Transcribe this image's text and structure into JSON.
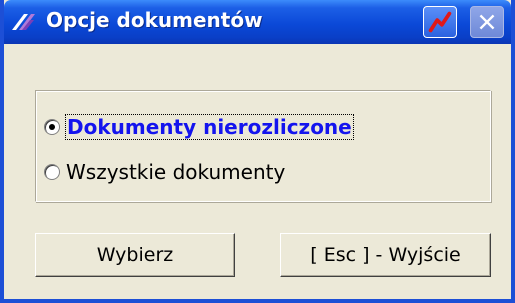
{
  "window": {
    "title": "Opcje dokumentów"
  },
  "titlebar": {
    "app_icon": "app-logo-icon",
    "special_button_icon": "zigzag-icon",
    "close_button_icon": "close-icon"
  },
  "options": {
    "items": [
      {
        "label": "Dokumenty nierozliczone",
        "selected": true
      },
      {
        "label": "Wszystkie dokumenty",
        "selected": false
      }
    ]
  },
  "buttons": {
    "select_label": "Wybierz",
    "exit_label": "[ Esc ] - Wyjście"
  },
  "colors": {
    "titlebar": "#0b49d8",
    "face": "#ece9d8",
    "selected_text": "#1414ee",
    "zigzag": "#e01818"
  }
}
